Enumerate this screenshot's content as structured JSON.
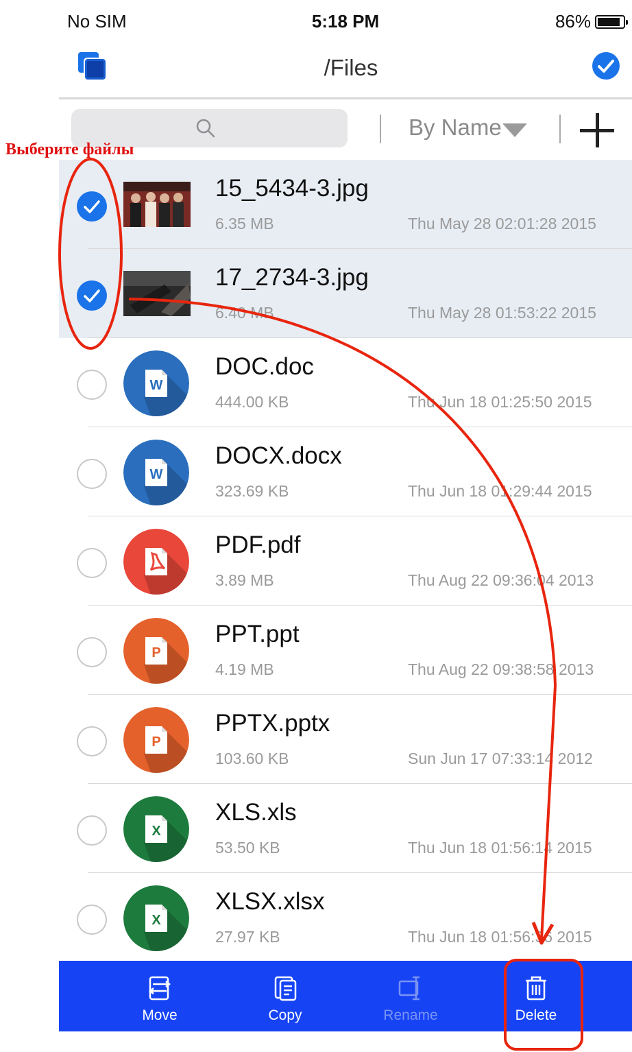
{
  "status": {
    "carrier": "No SIM",
    "time": "5:18 PM",
    "battery": "86%"
  },
  "nav": {
    "title": "/Files",
    "left_icon": "copy-stack-icon",
    "right_icon": "select-all-check-icon"
  },
  "toolbar_top": {
    "sort_label": "By Name",
    "search_icon": "search-icon",
    "add_icon": "plus-icon"
  },
  "annotation": {
    "text": "Выберите файлы",
    "color": "#e01010"
  },
  "files": [
    {
      "name": "15_5434-3.jpg",
      "size": "6.35 MB",
      "date": "Thu May 28 02:01:28 2015",
      "selected": true,
      "kind": "photo"
    },
    {
      "name": "17_2734-3.jpg",
      "size": "6.40 MB",
      "date": "Thu May 28 01:53:22 2015",
      "selected": true,
      "kind": "photo"
    },
    {
      "name": "DOC.doc",
      "size": "444.00 KB",
      "date": "Thu Jun 18 01:25:50 2015",
      "selected": false,
      "kind": "word",
      "letter": "W",
      "color": "#2a6ebd"
    },
    {
      "name": "DOCX.docx",
      "size": "323.69 KB",
      "date": "Thu Jun 18 01:29:44 2015",
      "selected": false,
      "kind": "word",
      "letter": "W",
      "color": "#2a6ebd"
    },
    {
      "name": "PDF.pdf",
      "size": "3.89 MB",
      "date": "Thu Aug 22 09:36:04 2013",
      "selected": false,
      "kind": "pdf",
      "letter": "",
      "color": "#e8473a"
    },
    {
      "name": "PPT.ppt",
      "size": "4.19 MB",
      "date": "Thu Aug 22 09:38:58 2013",
      "selected": false,
      "kind": "ppt",
      "letter": "P",
      "color": "#e5612b"
    },
    {
      "name": "PPTX.pptx",
      "size": "103.60 KB",
      "date": "Sun Jun 17 07:33:14 2012",
      "selected": false,
      "kind": "ppt",
      "letter": "P",
      "color": "#e5612b"
    },
    {
      "name": "XLS.xls",
      "size": "53.50 KB",
      "date": "Thu Jun 18 01:56:14 2015",
      "selected": false,
      "kind": "xls",
      "letter": "X",
      "color": "#1e7b3e"
    },
    {
      "name": "XLSX.xlsx",
      "size": "27.97 KB",
      "date": "Thu Jun 18 01:56:36 2015",
      "selected": false,
      "kind": "xls",
      "letter": "X",
      "color": "#1e7b3e"
    }
  ],
  "toolbar": {
    "buttons": [
      {
        "label": "Move",
        "icon": "move-icon",
        "enabled": true
      },
      {
        "label": "Copy",
        "icon": "copy-icon",
        "enabled": true
      },
      {
        "label": "Rename",
        "icon": "rename-icon",
        "enabled": false
      },
      {
        "label": "Delete",
        "icon": "trash-icon",
        "enabled": true
      }
    ],
    "background": "#1644f5"
  }
}
